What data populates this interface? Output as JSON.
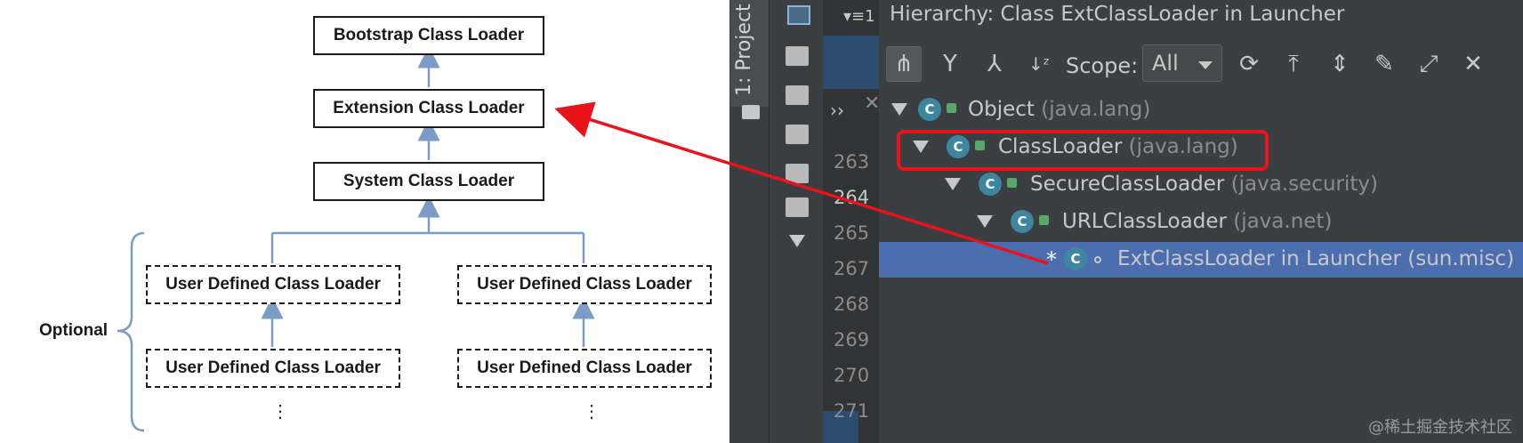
{
  "diagram": {
    "bootstrap_label": "Bootstrap Class Loader",
    "extension_label": "Extension Class Loader",
    "system_label": "System Class Loader",
    "user_defined_label": "User Defined Class Loader",
    "optional_label": "Optional",
    "ellipsis": "⋮"
  },
  "ide": {
    "project_tab": "1: Project",
    "hierarchy_title": "Hierarchy:  Class ExtClassLoader in Launcher",
    "scope_label": "Scope:",
    "scope_value": "All",
    "toolbar_icons": [
      "class-hierarchy-icon",
      "supertypes-icon",
      "subtypes-icon",
      "sort-alpha-icon",
      "refresh-icon",
      "export-icon",
      "expand-all-icon",
      "pin-icon",
      "open-external-icon",
      "close-icon"
    ],
    "line_numbers": [
      "263",
      "264",
      "265",
      "267",
      "268",
      "269",
      "270",
      "271"
    ],
    "tree": [
      {
        "name": "Object",
        "pkg": "(java.lang)"
      },
      {
        "name": "ClassLoader",
        "pkg": "(java.lang)"
      },
      {
        "name": "SecureClassLoader",
        "pkg": "(java.security)"
      },
      {
        "name": "URLClassLoader",
        "pkg": "(java.net)"
      },
      {
        "name": "ExtClassLoader in Launcher",
        "pkg": "(sun.misc)"
      }
    ],
    "selected_marker": "*",
    "watermark": "@稀土掘金技术社区"
  },
  "colors": {
    "ide_bg": "#3c3f41",
    "selected_row": "#4b6eaf",
    "highlight_red": "#e8131b",
    "connector_blue": "#7a9cc6"
  }
}
